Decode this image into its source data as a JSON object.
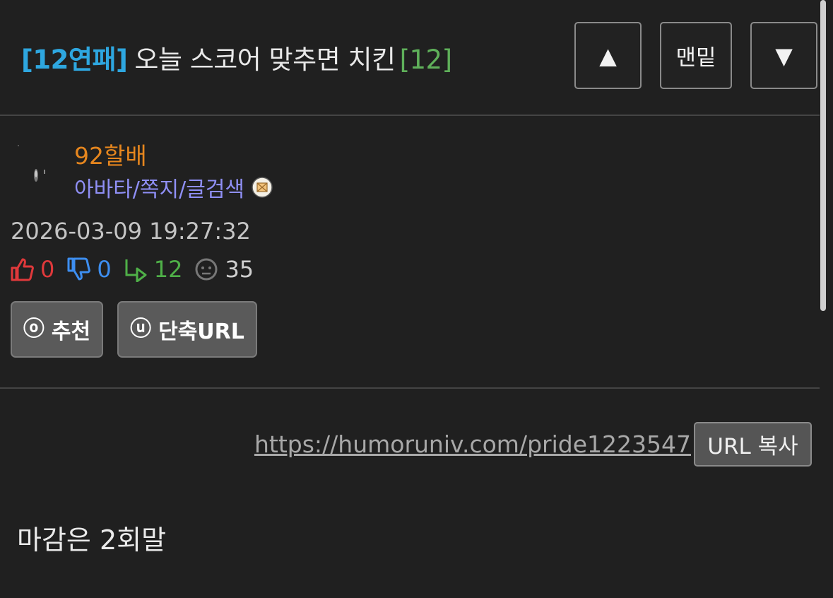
{
  "post": {
    "category_tag": "[12연패]",
    "title": "오늘 스코어 맞추면 치킨",
    "comment_count": "[12]"
  },
  "nav": {
    "up_label": "▲",
    "bottom_label": "맨밑",
    "down_label": "▼"
  },
  "author": {
    "name": "92할배",
    "links": "아바타/쪽지/글검색",
    "message_icon": "envelope-icon"
  },
  "meta": {
    "date": "2026-03-09 19:27:32",
    "likes": "0",
    "dislikes": "0",
    "replies": "12",
    "views": "35"
  },
  "actions": {
    "recommend_icon": "ⓞ",
    "recommend_label": "추천",
    "short_url_icon": "ⓤ",
    "short_url_label": "단축URL"
  },
  "share": {
    "url": "https://humoruniv.com/pride1223547",
    "copy_label": "URL 복사"
  },
  "content": {
    "body": "마감은 2회말"
  },
  "colors": {
    "background": "#202020",
    "tag": "#2ea7e0",
    "count": "#5fb05a",
    "author": "#e6861e",
    "links": "#8f8ff5",
    "like": "#e0393b",
    "dislike": "#3d8ef0",
    "reply": "#4fb048"
  }
}
